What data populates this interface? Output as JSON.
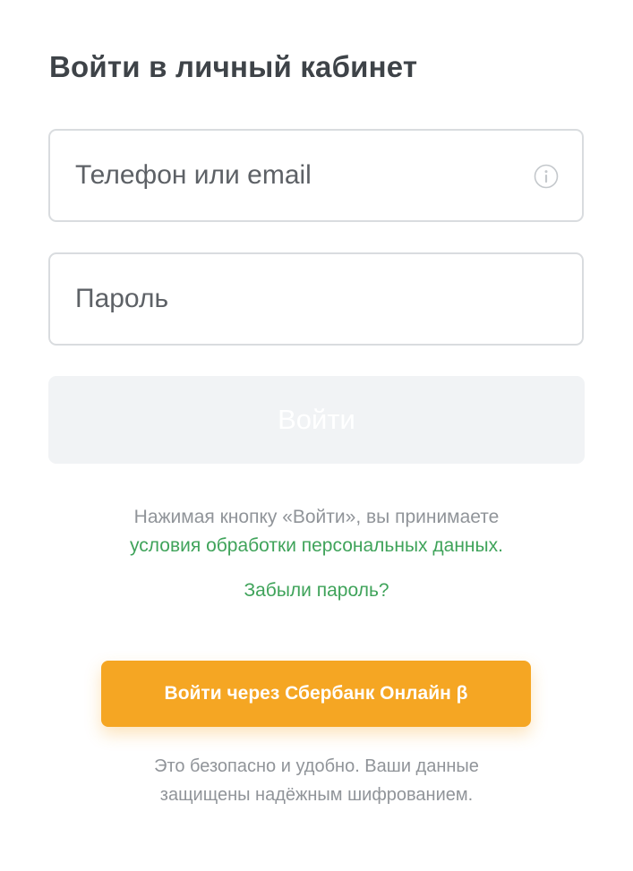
{
  "header": {
    "title": "Войти в личный кабинет"
  },
  "form": {
    "phone_placeholder": "Телефон или email",
    "password_placeholder": "Пароль",
    "login_label": "Войти"
  },
  "terms": {
    "prefix": "Нажимая кнопку «Войти», вы принимаете",
    "link": "условия обработки персональных данных."
  },
  "forgot_password": "Забыли пароль?",
  "sber": {
    "button_label": "Войти через Сбербанк Онлайн β",
    "note_line1": "Это безопасно и удобно. Ваши данные",
    "note_line2": "защищены надёжным шифрованием."
  },
  "icons": {
    "phone_field": "info-icon"
  },
  "colors": {
    "accent_green": "#3fa35a",
    "sber_orange": "#f5a623",
    "disabled_button": "#f1f3f5"
  }
}
